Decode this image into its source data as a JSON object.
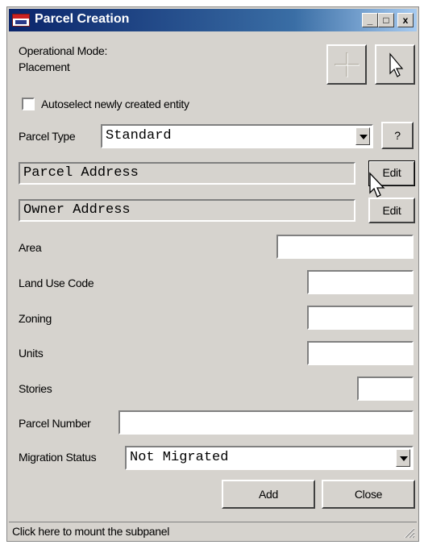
{
  "window": {
    "title": "Parcel Creation",
    "controls": {
      "minimize": "_",
      "maximize": "□",
      "close": "x"
    }
  },
  "mode": {
    "line1": "Operational Mode:",
    "line2": "Placement"
  },
  "autoselect": {
    "label": "Autoselect newly created entity",
    "checked": false
  },
  "parcel_type": {
    "label": "Parcel Type",
    "value": "Standard",
    "help": "?"
  },
  "parcel_address": {
    "value": "Parcel Address",
    "edit": "Edit"
  },
  "owner_address": {
    "value": "Owner Address",
    "edit": "Edit"
  },
  "fields": {
    "area": {
      "label": "Area",
      "value": ""
    },
    "land_use_code": {
      "label": "Land Use Code",
      "value": ""
    },
    "zoning": {
      "label": "Zoning",
      "value": ""
    },
    "units": {
      "label": "Units",
      "value": ""
    },
    "stories": {
      "label": "Stories",
      "value": ""
    },
    "parcel_number": {
      "label": "Parcel Number",
      "value": ""
    }
  },
  "migration_status": {
    "label": "Migration Status",
    "value": "Not Migrated"
  },
  "buttons": {
    "add": "Add",
    "close": "Close"
  },
  "status": {
    "text": "Click here to mount the subpanel"
  },
  "icons": [
    "crosshair-icon",
    "pointer-arrow-icon",
    "dropdown-arrow-icon",
    "mouse-cursor-icon",
    "resize-grip-icon",
    "app-icon"
  ]
}
